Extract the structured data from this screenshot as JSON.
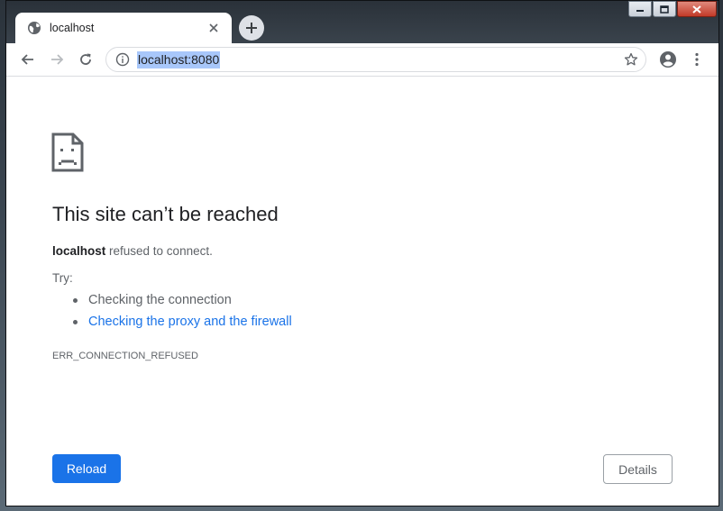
{
  "tab": {
    "title": "localhost"
  },
  "omnibox": {
    "url": "localhost:8080"
  },
  "page": {
    "heading": "This site can’t be reached",
    "host": "localhost",
    "refused_text": " refused to connect.",
    "try_label": "Try:",
    "suggestions": [
      {
        "text": "Checking the connection",
        "is_link": false
      },
      {
        "text": "Checking the proxy and the firewall",
        "is_link": true
      }
    ],
    "error_code": "ERR_CONNECTION_REFUSED",
    "reload_label": "Reload",
    "details_label": "Details"
  },
  "colors": {
    "accent": "#1a73e8",
    "text_primary": "#202124",
    "text_secondary": "#5f6368"
  }
}
